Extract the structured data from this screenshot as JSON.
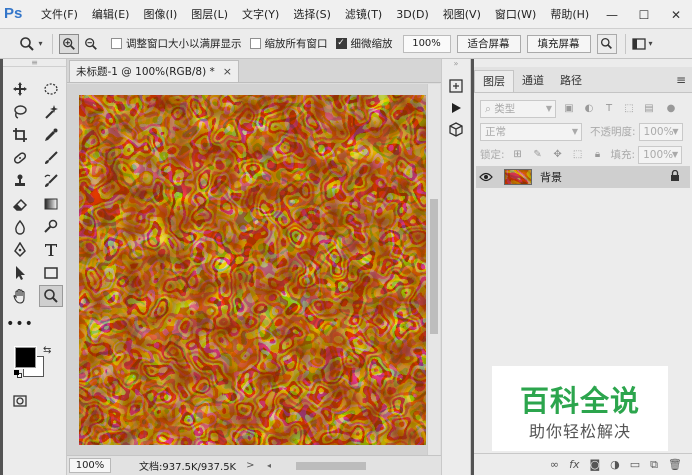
{
  "app": {
    "logo": "Ps",
    "menu": [
      "文件(F)",
      "编辑(E)",
      "图像(I)",
      "图层(L)",
      "文字(Y)",
      "选择(S)",
      "滤镜(T)",
      "3D(D)",
      "视图(V)",
      "窗口(W)",
      "帮助(H)"
    ],
    "window_controls": {
      "minimize": "—",
      "maximize": "☐",
      "close": "✕"
    }
  },
  "options": {
    "tool_icon": "zoom-icon",
    "resize_windows_label": "调整窗口大小以满屏显示",
    "resize_windows_checked": false,
    "zoom_all_label": "缩放所有窗口",
    "zoom_all_checked": false,
    "scrubby_zoom_label": "细微缩放",
    "scrubby_zoom_checked": true,
    "zoom_value": "100%",
    "fit_screen_label": "适合屏幕",
    "fill_screen_label": "填充屏幕"
  },
  "document": {
    "tab_title": "未标题-1 @ 100%(RGB/8) *",
    "tab_close": "×",
    "status_zoom": "100%",
    "status_doc": "文档:937.5K/937.5K",
    "status_arrow": ">"
  },
  "layers": {
    "tabs": [
      "图层",
      "通道",
      "路径"
    ],
    "active_tab": "图层",
    "filter_label": "类型",
    "blend_mode": "正常",
    "opacity_label": "不透明度:",
    "opacity_value": "100%",
    "lock_label": "锁定:",
    "fill_label": "填充:",
    "fill_value": "100%",
    "layer_name": "背景",
    "footer_icons": [
      "link-icon",
      "fx-icon",
      "mask-icon",
      "adjustment-icon",
      "folder-icon",
      "new-layer-icon",
      "trash-icon"
    ],
    "footer_fx": "fx"
  },
  "watermark": {
    "title": "百科全说",
    "subtitle": "助你轻松解决"
  },
  "colors": {
    "foreground": "#000000",
    "background": "#ffffff",
    "accent_logo": "#3476c9",
    "watermark_green": "#2ca54d"
  }
}
